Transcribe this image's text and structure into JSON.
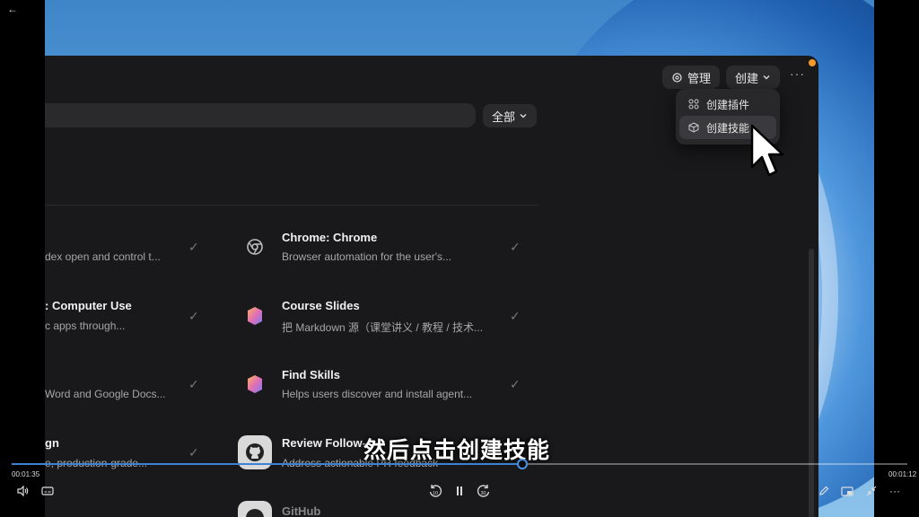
{
  "player": {
    "back_icon": "back-arrow-icon",
    "elapsed": "00:01:35",
    "duration": "00:01:12",
    "progress": 0.57,
    "subtitle": "然后点击创建技能",
    "controls": [
      "volume-icon",
      "captions-icon",
      "rewind-10-icon",
      "pause-icon",
      "forward-30-icon",
      "edit-icon",
      "miniplayer-icon",
      "collapse-icon",
      "more-icon"
    ]
  },
  "app": {
    "manage_label": "管理",
    "create_label": "创建",
    "more_label": "···",
    "menu": {
      "items": [
        {
          "label": "创建插件",
          "icon": "plugin-grid-icon"
        },
        {
          "label": "创建技能",
          "icon": "cube-icon"
        }
      ]
    },
    "filter_label": "全部",
    "skills_left": [
      {
        "title": "",
        "desc": "dex open and control t..."
      },
      {
        "title": ": Computer Use",
        "desc": "c apps through..."
      },
      {
        "title": "",
        "desc": "Word and Google Docs..."
      },
      {
        "title": "gn",
        "desc": "e, production-grade..."
      }
    ],
    "skills_right": [
      {
        "title": "Chrome: Chrome",
        "desc": "Browser automation for the user's...",
        "icon": "chrome-icon"
      },
      {
        "title": "Course Slides",
        "desc": "把 Markdown 源（课堂讲义 / 教程 / 技术...",
        "icon": "layers-icon"
      },
      {
        "title": "Find Skills",
        "desc": "Helps users discover and install agent...",
        "icon": "layers-icon"
      },
      {
        "title": "Review Follow-",
        "desc": "Address actionable PR feedback",
        "icon": "github-icon"
      },
      {
        "title": "GitHub",
        "desc": "",
        "icon": "github-icon"
      }
    ]
  },
  "colors": {
    "accent": "#3b82d6",
    "window_bg": "#19191b",
    "status_dot": "#f39a2a"
  }
}
